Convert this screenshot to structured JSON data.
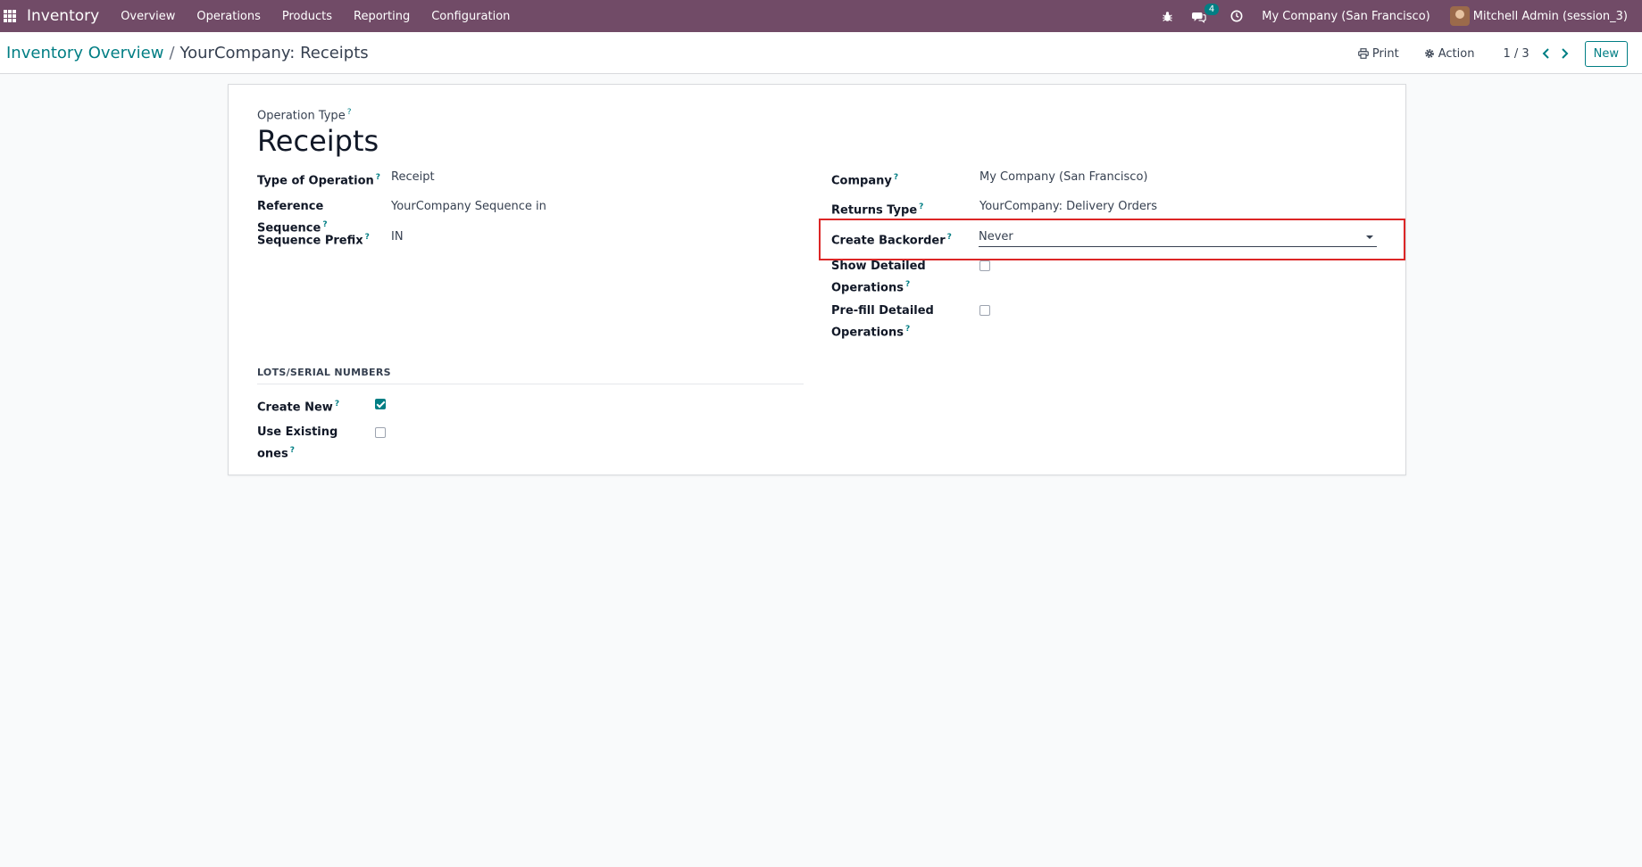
{
  "navbar": {
    "app_name": "Inventory",
    "menu": [
      "Overview",
      "Operations",
      "Products",
      "Reporting",
      "Configuration"
    ],
    "messages_badge": "4",
    "company": "My Company (San Francisco)",
    "user": "Mitchell Admin (session_3)",
    "icons": [
      "apps-icon",
      "bug-icon",
      "chat-icon",
      "clock-icon"
    ]
  },
  "control": {
    "breadcrumb_parent": "Inventory Overview",
    "breadcrumb_sep": "/",
    "breadcrumb_current": "YourCompany: Receipts",
    "print_label": "Print",
    "action_label": "Action",
    "pager": "1 / 3",
    "new_label": "New"
  },
  "form": {
    "name_label": "Operation Type",
    "name": "Receipts",
    "help_mark": "?",
    "left": {
      "type_label": "Type of Operation",
      "type_value": "Receipt",
      "ref_seq_label": "Reference Sequence",
      "ref_seq_value": "YourCompany Sequence in",
      "prefix_label": "Sequence Prefix",
      "prefix_value": "IN"
    },
    "right": {
      "company_label": "Company",
      "company_value": "My Company (San Francisco)",
      "returns_label": "Returns Type",
      "returns_value": "YourCompany: Delivery Orders",
      "backorder_label": "Create Backorder",
      "backorder_value": "Never",
      "show_detailed_label_1": "Show Detailed",
      "show_detailed_label_2": "Operations",
      "prefill_label_1": "Pre-fill Detailed",
      "prefill_label_2": "Operations"
    },
    "lots": {
      "section_title": "LOTS/SERIAL NUMBERS",
      "create_new_label": "Create New",
      "create_new_checked": true,
      "use_existing_label": "Use Existing ones",
      "use_existing_checked": false
    }
  },
  "colors": {
    "navbar": "#714b67",
    "accent": "#017e84",
    "highlight": "#dc2626"
  }
}
